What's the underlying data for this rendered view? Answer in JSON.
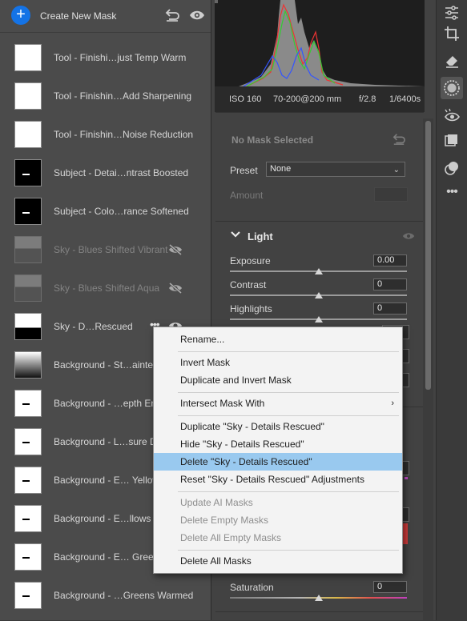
{
  "mask_panel": {
    "create_label": "Create New Mask",
    "items": [
      {
        "label": "Tool - Finishi…just Temp Warm",
        "thumb": "white-blank",
        "hidden": false
      },
      {
        "label": "Tool - Finishin…Add Sharpening",
        "thumb": "white-blank",
        "hidden": false
      },
      {
        "label": "Tool - Finishin…Noise Reduction",
        "thumb": "white-blank",
        "hidden": false
      },
      {
        "label": "Subject - Detai…ntrast Boosted",
        "thumb": "black-subject",
        "hidden": false
      },
      {
        "label": "Subject - Colo…rance Softened",
        "thumb": "black-subject",
        "hidden": false
      },
      {
        "label": "Sky - Blues Shifted Vibrant",
        "thumb": "grey-sky",
        "hidden": true
      },
      {
        "label": "Sky - Blues Shifted Aqua",
        "thumb": "grey-sky",
        "hidden": true
      },
      {
        "label": "Sky - D…Rescued",
        "thumb": "sky",
        "hidden": false,
        "selected_menu": true
      },
      {
        "label": "Background - St…ainterly",
        "thumb": "gradient",
        "hidden": false
      },
      {
        "label": "Background - …epth Enha",
        "thumb": "white-subject",
        "hidden": false
      },
      {
        "label": "Background - L…sure Dar",
        "thumb": "white-subject",
        "hidden": false
      },
      {
        "label": "Background - E… Yellows",
        "thumb": "white-subject",
        "hidden": false
      },
      {
        "label": "Background - E…llows Or",
        "thumb": "white-subject",
        "hidden": false
      },
      {
        "label": "Background - E… Greens",
        "thumb": "white-subject",
        "hidden": false
      },
      {
        "label": "Background - …Greens Warmed",
        "thumb": "white-subject",
        "hidden": false
      }
    ]
  },
  "camera_info": {
    "iso": "ISO 160",
    "lens": "70-200@200 mm",
    "aperture": "f/2.8",
    "shutter": "1/6400s"
  },
  "mask_settings": {
    "title": "No Mask Selected",
    "preset_label": "Preset",
    "preset_value": "None",
    "amount_label": "Amount"
  },
  "light": {
    "title": "Light",
    "sliders": [
      {
        "label": "Exposure",
        "value": "0.00"
      },
      {
        "label": "Contrast",
        "value": "0"
      },
      {
        "label": "Highlights",
        "value": "0"
      }
    ],
    "saturation_label": "Saturation",
    "saturation_value": "0"
  },
  "context_menu": {
    "rename": "Rename...",
    "invert": "Invert Mask",
    "duplicate_invert": "Duplicate and Invert Mask",
    "intersect": "Intersect Mask With",
    "duplicate": "Duplicate \"Sky - Details Rescued\"",
    "hide": "Hide \"Sky - Details Rescued\"",
    "delete": "Delete \"Sky - Details Rescued\"",
    "reset": "Reset \"Sky - Details Rescued\" Adjustments",
    "update_ai": "Update AI Masks",
    "delete_empty": "Delete Empty Masks",
    "delete_all_empty": "Delete All Empty Masks",
    "delete_all": "Delete All Masks"
  },
  "colors": {
    "accent": "#1473e6",
    "menu_highlight": "#99c9ef"
  }
}
